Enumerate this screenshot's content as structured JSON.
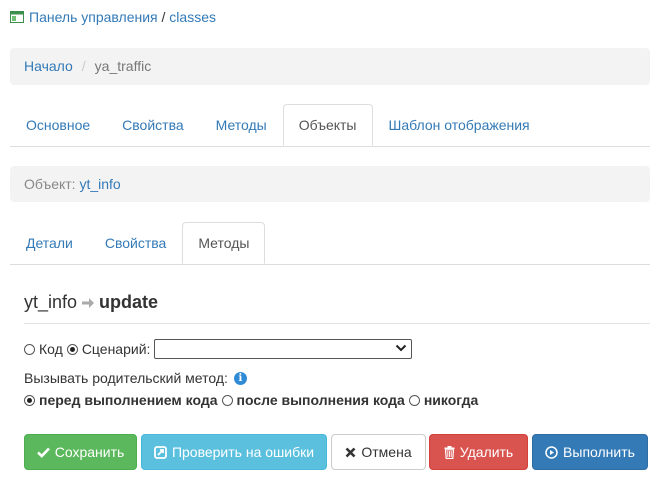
{
  "header": {
    "panel_link": "Панель управления",
    "separator": " / ",
    "section": "classes"
  },
  "breadcrumb": {
    "home": "Начало",
    "sep": "/",
    "current": "ya_traffic"
  },
  "class_tabs": [
    "Основное",
    "Свойства",
    "Методы",
    "Объекты",
    "Шаблон отображения"
  ],
  "class_tabs_active": "Объекты",
  "object_bar": {
    "label": "Объект:",
    "name": "yt_info"
  },
  "object_tabs": [
    "Детали",
    "Свойства",
    "Методы"
  ],
  "object_tabs_active": "Методы",
  "method": {
    "object": "yt_info",
    "name": "update"
  },
  "editor_mode": {
    "code_label": "Код",
    "script_label": "Сценарий:",
    "selected": "script",
    "script_value": ""
  },
  "call_parent": {
    "label": "Вызывать родительский метод:",
    "options": [
      "перед выполнением кода",
      "после выполнения кода",
      "никогда"
    ],
    "selected": "перед выполнением кода"
  },
  "buttons": {
    "save": "Сохранить",
    "check": "Проверить на ошибки",
    "cancel": "Отмена",
    "delete": "Удалить",
    "run": "Выполнить"
  },
  "colors": {
    "link": "#337ab7",
    "save": "#5cb85c",
    "check": "#5bc0de",
    "delete": "#d9534f",
    "run": "#337ab7"
  },
  "icons": {
    "header": "window-icon",
    "save": "checkmark-icon",
    "check": "external-check-icon",
    "cancel": "times-icon",
    "delete": "trash-icon",
    "run": "play-circle-icon",
    "info": "info-icon"
  }
}
